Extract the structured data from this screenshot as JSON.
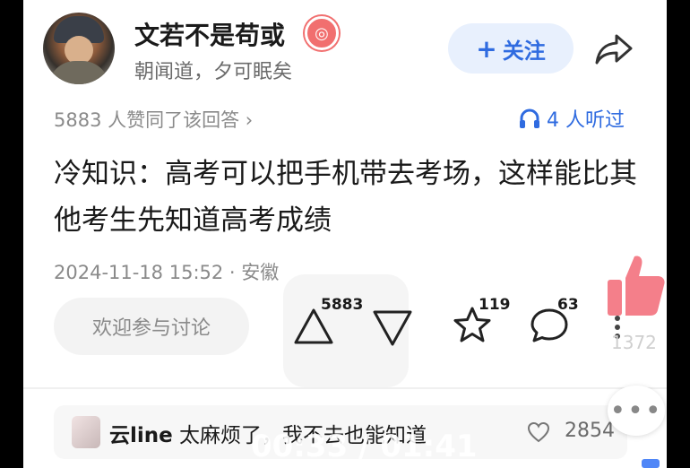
{
  "author": {
    "name": "文若不是苟或",
    "badge_icon": "medal-icon",
    "bio": "朝闻道，夕可眠矣"
  },
  "actions": {
    "follow_plus": "+",
    "follow_label": "关注",
    "share_icon": "share-arrow-icon"
  },
  "stats": {
    "likes_text": "5883 人赞同了该回答 ›",
    "listen_text": "4 人听过",
    "listen_icon": "headphones-icon"
  },
  "answer": {
    "text": "冷知识：高考可以把手机带去考场，这样能比其他考生先知道高考成绩",
    "meta": "2024-11-18 15:52 · 安徽"
  },
  "toolbar": {
    "discuss_placeholder": "欢迎参与讨论",
    "upvote_count": "5883",
    "star_count": "119",
    "comment_count": "63"
  },
  "overlay": {
    "thumb_count": "1372",
    "timer": "00:33 / 01:41",
    "thumb_color": "#f47f8a",
    "chat_dots": "•••"
  },
  "top_comment": {
    "user": "云line",
    "text": "太麻烦了，我不去也能知道",
    "likes": "2854"
  },
  "colors": {
    "accent": "#2f6be0",
    "follow_bg": "#e8f0fd"
  }
}
